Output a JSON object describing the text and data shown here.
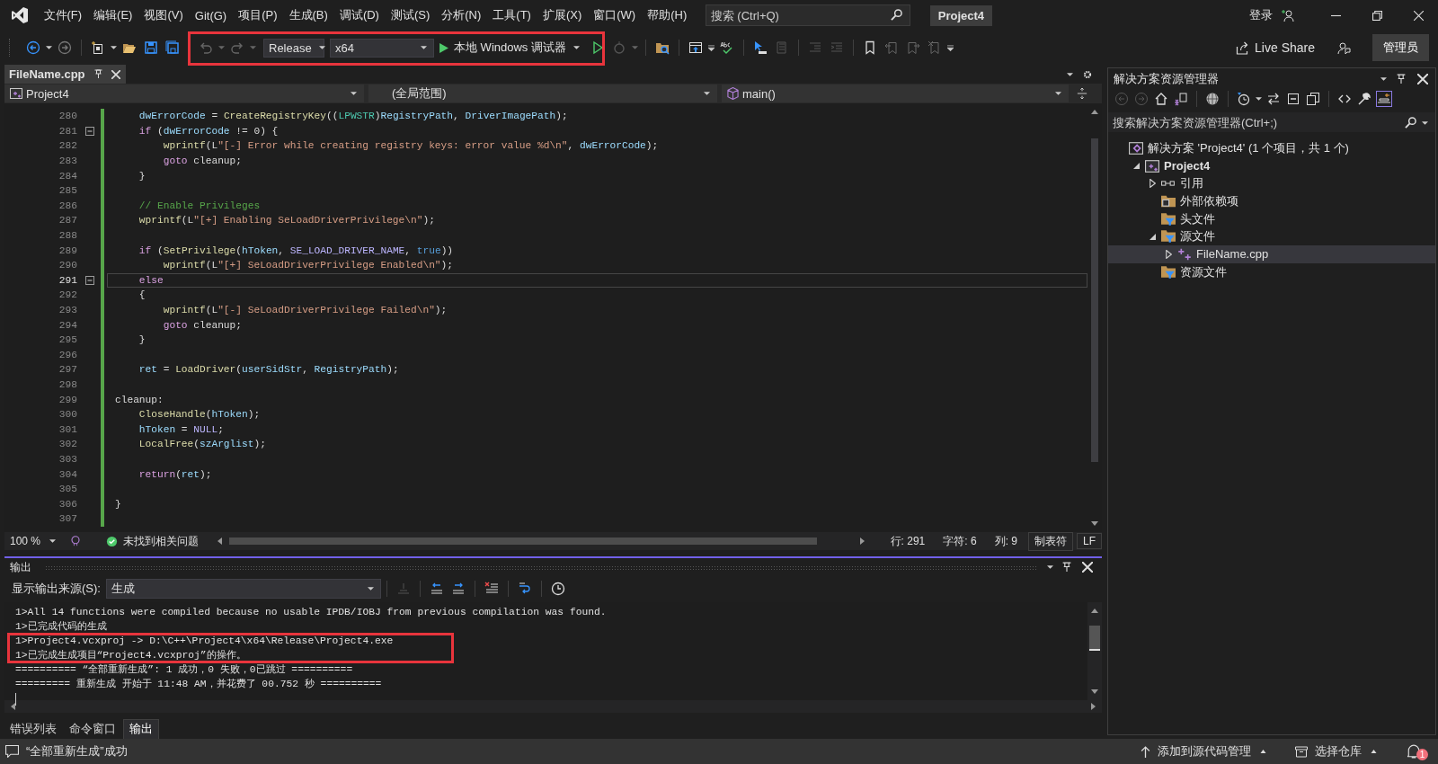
{
  "menu": [
    "文件(F)",
    "编辑(E)",
    "视图(V)",
    "Git(G)",
    "项目(P)",
    "生成(B)",
    "调试(D)",
    "测试(S)",
    "分析(N)",
    "工具(T)",
    "扩展(X)",
    "窗口(W)",
    "帮助(H)"
  ],
  "search": {
    "placeholder": "搜索 (Ctrl+Q)"
  },
  "solution_name": "Project4",
  "account": "登录",
  "toolbar": {
    "configuration": "Release",
    "platform": "x64",
    "debugger": "本地 Windows 调试器",
    "live_share": "Live Share",
    "admin": "管理员"
  },
  "editor": {
    "tab": {
      "label": "FileName.cpp",
      "selected": true
    },
    "nav": [
      "Project4",
      "(全局范围)",
      "main()"
    ],
    "lines": [
      {
        "number": "280",
        "fold": false,
        "current": false,
        "tokens": [
          {
            "text": "    dwErrorCode",
            "kind": "var"
          },
          {
            "text": " = ",
            "kind": "plain"
          },
          {
            "text": "CreateRegistryKey",
            "kind": "fn"
          },
          {
            "text": "((",
            "kind": "plain"
          },
          {
            "text": "LPWSTR",
            "kind": "type"
          },
          {
            "text": ")",
            "kind": "plain"
          },
          {
            "text": "RegistryPath",
            "kind": "var"
          },
          {
            "text": ", ",
            "kind": "plain"
          },
          {
            "text": "DriverImagePath",
            "kind": "var"
          },
          {
            "text": ");",
            "kind": "plain"
          }
        ]
      },
      {
        "number": "281",
        "fold": true,
        "current": false,
        "tokens": [
          {
            "text": "    if",
            "kind": "ctl"
          },
          {
            "text": " (",
            "kind": "plain"
          },
          {
            "text": "dwErrorCode",
            "kind": "var"
          },
          {
            "text": " != 0) {",
            "kind": "plain"
          }
        ]
      },
      {
        "number": "282",
        "fold": false,
        "current": false,
        "tokens": [
          {
            "text": "        wprintf",
            "kind": "fn"
          },
          {
            "text": "(L",
            "kind": "plain"
          },
          {
            "text": "\"[-] Error while creating registry keys: error value %d\\n\"",
            "kind": "str"
          },
          {
            "text": ", ",
            "kind": "plain"
          },
          {
            "text": "dwErrorCode",
            "kind": "var"
          },
          {
            "text": ");",
            "kind": "plain"
          }
        ]
      },
      {
        "number": "283",
        "fold": false,
        "current": false,
        "tokens": [
          {
            "text": "        goto",
            "kind": "ctl"
          },
          {
            "text": " cleanup;",
            "kind": "plain"
          }
        ]
      },
      {
        "number": "284",
        "fold": false,
        "current": false,
        "tokens": [
          {
            "text": "    }",
            "kind": "plain"
          }
        ]
      },
      {
        "number": "285",
        "fold": false,
        "current": false
      },
      {
        "number": "286",
        "fold": false,
        "current": false,
        "tokens": [
          {
            "text": "    // Enable Privileges",
            "kind": "cmt"
          }
        ]
      },
      {
        "number": "287",
        "fold": false,
        "current": false,
        "tokens": [
          {
            "text": "    wprintf",
            "kind": "fn"
          },
          {
            "text": "(L",
            "kind": "plain"
          },
          {
            "text": "\"[+] Enabling SeLoadDriverPrivilege\\n\"",
            "kind": "str"
          },
          {
            "text": ");",
            "kind": "plain"
          }
        ]
      },
      {
        "number": "288",
        "fold": false,
        "current": false
      },
      {
        "number": "289",
        "fold": false,
        "current": false,
        "tokens": [
          {
            "text": "    if",
            "kind": "ctl"
          },
          {
            "text": " (",
            "kind": "plain"
          },
          {
            "text": "SetPrivilege",
            "kind": "fn"
          },
          {
            "text": "(",
            "kind": "plain"
          },
          {
            "text": "hToken",
            "kind": "var"
          },
          {
            "text": ", ",
            "kind": "plain"
          },
          {
            "text": "SE_LOAD_DRIVER_NAME",
            "kind": "macro"
          },
          {
            "text": ", ",
            "kind": "plain"
          },
          {
            "text": "true",
            "kind": "kw"
          },
          {
            "text": "))",
            "kind": "plain"
          }
        ]
      },
      {
        "number": "290",
        "fold": false,
        "current": false,
        "tokens": [
          {
            "text": "        wprintf",
            "kind": "fn"
          },
          {
            "text": "(L",
            "kind": "plain"
          },
          {
            "text": "\"[+] SeLoadDriverPrivilege Enabled\\n\"",
            "kind": "str"
          },
          {
            "text": ");",
            "kind": "plain"
          }
        ]
      },
      {
        "number": "291",
        "fold": true,
        "current": true,
        "tokens": [
          {
            "text": "    else",
            "kind": "ctl"
          }
        ]
      },
      {
        "number": "292",
        "fold": false,
        "current": false,
        "tokens": [
          {
            "text": "    {",
            "kind": "plain"
          }
        ]
      },
      {
        "number": "293",
        "fold": false,
        "current": false,
        "tokens": [
          {
            "text": "        wprintf",
            "kind": "fn"
          },
          {
            "text": "(L",
            "kind": "plain"
          },
          {
            "text": "\"[-] SeLoadDriverPrivilege Failed\\n\"",
            "kind": "str"
          },
          {
            "text": ");",
            "kind": "plain"
          }
        ]
      },
      {
        "number": "294",
        "fold": false,
        "current": false,
        "tokens": [
          {
            "text": "        goto",
            "kind": "ctl"
          },
          {
            "text": " cleanup;",
            "kind": "plain"
          }
        ]
      },
      {
        "number": "295",
        "fold": false,
        "current": false,
        "tokens": [
          {
            "text": "    }",
            "kind": "plain"
          }
        ]
      },
      {
        "number": "296",
        "fold": false,
        "current": false
      },
      {
        "number": "297",
        "fold": false,
        "current": false,
        "tokens": [
          {
            "text": "    ret",
            "kind": "var"
          },
          {
            "text": " = ",
            "kind": "plain"
          },
          {
            "text": "LoadDriver",
            "kind": "fn"
          },
          {
            "text": "(",
            "kind": "plain"
          },
          {
            "text": "userSidStr",
            "kind": "var"
          },
          {
            "text": ", ",
            "kind": "plain"
          },
          {
            "text": "RegistryPath",
            "kind": "var"
          },
          {
            "text": ");",
            "kind": "plain"
          }
        ]
      },
      {
        "number": "298",
        "fold": false,
        "current": false
      },
      {
        "number": "299",
        "fold": false,
        "current": false,
        "tokens": [
          {
            "text": "cleanup:",
            "kind": "plain"
          }
        ]
      },
      {
        "number": "300",
        "fold": false,
        "current": false,
        "tokens": [
          {
            "text": "    CloseHandle",
            "kind": "fn"
          },
          {
            "text": "(",
            "kind": "plain"
          },
          {
            "text": "hToken",
            "kind": "var"
          },
          {
            "text": ");",
            "kind": "plain"
          }
        ]
      },
      {
        "number": "301",
        "fold": false,
        "current": false,
        "tokens": [
          {
            "text": "    hToken",
            "kind": "var"
          },
          {
            "text": " = ",
            "kind": "plain"
          },
          {
            "text": "NULL",
            "kind": "macro"
          },
          {
            "text": ";",
            "kind": "plain"
          }
        ]
      },
      {
        "number": "302",
        "fold": false,
        "current": false,
        "tokens": [
          {
            "text": "    LocalFree",
            "kind": "fn"
          },
          {
            "text": "(",
            "kind": "plain"
          },
          {
            "text": "szArglist",
            "kind": "var"
          },
          {
            "text": ");",
            "kind": "plain"
          }
        ]
      },
      {
        "number": "303",
        "fold": false,
        "current": false
      },
      {
        "number": "304",
        "fold": false,
        "current": false,
        "tokens": [
          {
            "text": "    return",
            "kind": "ctl"
          },
          {
            "text": "(",
            "kind": "plain"
          },
          {
            "text": "ret",
            "kind": "var"
          },
          {
            "text": ");",
            "kind": "plain"
          }
        ]
      },
      {
        "number": "305",
        "fold": false,
        "current": false
      },
      {
        "number": "306",
        "fold": false,
        "current": false,
        "tokens": [
          {
            "text": "}",
            "kind": "plain"
          }
        ]
      },
      {
        "number": "307",
        "fold": false,
        "current": false
      }
    ],
    "zoom": "100 %",
    "issues": "未找到相关问题",
    "position": [
      "行: 291",
      "字符: 6",
      "列: 9"
    ],
    "indentation": "制表符",
    "line_ending": "LF"
  },
  "output": {
    "title": "输出",
    "source_label": "显示输出来源(S):",
    "source": "生成",
    "lines": [
      "1>All 14 functions were compiled because no usable IPDB/IOBJ from previous compilation was found.",
      "1>已完成代码的生成",
      "1>Project4.vcxproj -> D:\\C++\\Project4\\x64\\Release\\Project4.exe",
      "1>已完成生成项目“Project4.vcxproj”的操作。",
      "========== “全部重新生成”: 1 成功，0 失败，0已跳过 ==========",
      "========= 重新生成 开始于 11:48 AM，并花费了 00.752 秒 =========="
    ]
  },
  "bottom_tabs": [
    {
      "label": "错误列表",
      "selected": false
    },
    {
      "label": "命令窗口",
      "selected": false
    },
    {
      "label": "输出",
      "selected": true
    }
  ],
  "solution_explorer": {
    "title": "解决方案资源管理器",
    "search": {
      "placeholder": "搜索解决方案资源管理器(Ctrl+;)"
    },
    "tree": [
      {
        "label": "解决方案 'Project4' (1 个项目，共 1 个)",
        "kind": "solution",
        "selected": false,
        "children": [
          {
            "label": "Project4",
            "kind": "project",
            "expanded": true,
            "selected": false,
            "children": [
              {
                "label": "引用",
                "kind": "references",
                "expanded": false,
                "selected": false
              },
              {
                "label": "外部依赖项",
                "kind": "external",
                "selected": false
              },
              {
                "label": "头文件",
                "kind": "filter",
                "selected": false
              },
              {
                "label": "源文件",
                "kind": "filter",
                "expanded": true,
                "selected": false,
                "children": [
                  {
                    "label": "FileName.cpp",
                    "kind": "cpp",
                    "expanded": false,
                    "selected": true
                  }
                ]
              },
              {
                "label": "资源文件",
                "kind": "filter",
                "selected": false
              }
            ]
          }
        ]
      }
    ]
  },
  "status_bar": {
    "message": "“全部重新生成”成功",
    "source_control": "添加到源代码管理",
    "repository": "选择仓库",
    "notifications": "1"
  }
}
